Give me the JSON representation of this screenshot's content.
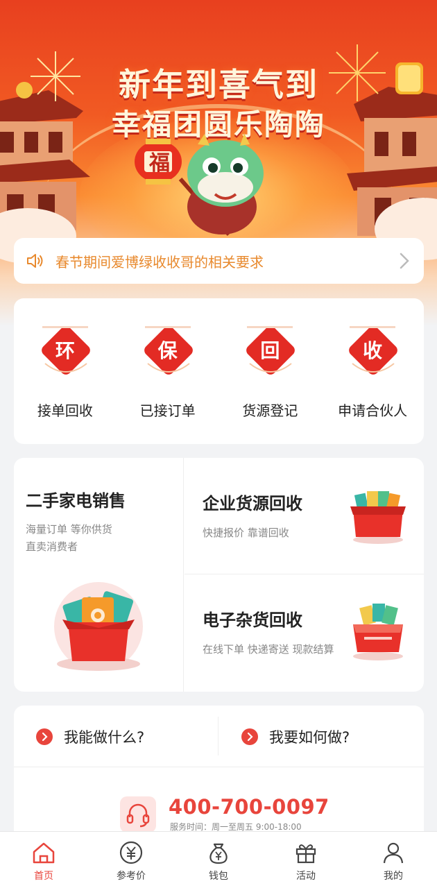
{
  "banner": {
    "title_line1": "新年到喜气到",
    "title_line2": "幸福团圆乐陶陶",
    "fu_char": "福"
  },
  "notice": {
    "icon": "speaker-icon",
    "text": "春节期间爱博绿收收哥的相关要求",
    "accent_color": "#e8892d"
  },
  "quick_menu": [
    {
      "glyph": "环",
      "label": "接单回收"
    },
    {
      "glyph": "保",
      "label": "已接订单"
    },
    {
      "glyph": "回",
      "label": "货源登记"
    },
    {
      "glyph": "收",
      "label": "申请合伙人"
    }
  ],
  "services": {
    "left": {
      "title": "二手家电销售",
      "sub_line1": "海量订单  等你供货",
      "sub_line2": "直卖消费者"
    },
    "top_right": {
      "title": "企业货源回收",
      "sub": "快捷报价 靠谱回收"
    },
    "bottom_right": {
      "title": "电子杂货回收",
      "sub": "在线下单 快递寄送 现款结算"
    }
  },
  "help": {
    "q1": "我能做什么?",
    "q2": "我要如何做?",
    "phone": "400-700-0097",
    "hours": "服务时间：周一至周五 9:00-18:00"
  },
  "tabbar": [
    {
      "label": "首页",
      "icon": "home-icon",
      "active": true
    },
    {
      "label": "参考价",
      "icon": "yuan-circle-icon",
      "active": false
    },
    {
      "label": "钱包",
      "icon": "money-bag-icon",
      "active": false
    },
    {
      "label": "活动",
      "icon": "gift-icon",
      "active": false
    },
    {
      "label": "我的",
      "icon": "user-icon",
      "active": false
    }
  ],
  "colors": {
    "brand_red": "#e8453c",
    "banner_orange": "#f15a23"
  }
}
